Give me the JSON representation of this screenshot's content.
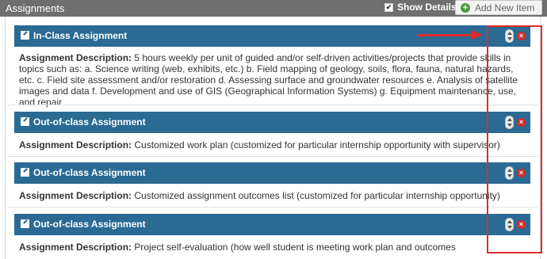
{
  "header": {
    "title": "Assignments",
    "show_details_label": "Show Details",
    "show_details_checked": true,
    "add_button_label": "Add New Item"
  },
  "items": [
    {
      "title": "In-Class Assignment",
      "desc_label": "Assignment Description:",
      "desc_text": "5 hours weekly per unit of guided and/or self-driven activities/projects that provide skills in topics such as: a. Science writing (web, exhibits, etc.) b. Field mapping of geology, soils, flora, fauna, natural hazards, etc. c. Field site assessment and/or restoration d. Assessing surface and groundwater resources e. Analysis of satellite images and data f. Development and use of GIS (Geographical Information Systems) g. Equipment maintenance, use, and repair"
    },
    {
      "title": "Out-of-class Assignment",
      "desc_label": "Assignment Description:",
      "desc_text": "Customized work plan (customized for particular internship opportunity with supervisor)"
    },
    {
      "title": "Out-of-class Assignment",
      "desc_label": "Assignment Description:",
      "desc_text": "Customized assignment outcomes list (customized for particular internship opportunity)"
    },
    {
      "title": "Out-of-class Assignment",
      "desc_label": "Assignment Description:",
      "desc_text": "Project self-evaluation (how well student is meeting work plan and outcomes"
    }
  ],
  "colors": {
    "header_bg": "#6f6f6f",
    "item_bar_bg": "#2a6a93",
    "delete_red": "#d52b2b",
    "annotation_red": "#e02a2a",
    "add_icon_green": "#4a9a3a"
  },
  "icons": {
    "edit": "edit-icon",
    "move": "move-icon",
    "delete": "delete-icon",
    "add": "plus-icon",
    "checkbox": "checkbox-checked-icon"
  }
}
